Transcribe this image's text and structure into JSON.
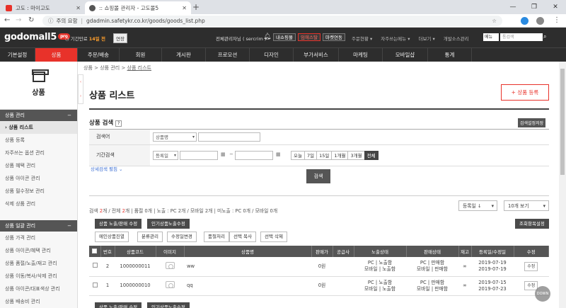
{
  "browser": {
    "tabs": [
      {
        "title": "고도 : 마이고도",
        "favicon_color": "#e8322a"
      },
      {
        "title": ":: 쇼핑몰 관리자 - 고도몰5",
        "favicon_color": "#555555"
      }
    ],
    "url_security": "주의 요함",
    "url": "gdadmin.safetykr.co.kr/goods/goods_list.php",
    "window_controls": [
      "—",
      "❐",
      "✕"
    ]
  },
  "header": {
    "logo_text": "godomall",
    "logo_num": "5",
    "logo_badge": "pro",
    "trial_prefix": "기간만료",
    "trial_days": "14일 전",
    "extend_label": "연장",
    "admin_label": "전체관리자님 ( sercrim )",
    "buttons": [
      "내쇼핑몰",
      "임에스탈",
      "마켓연동"
    ],
    "links": [
      "주문현황 ▾",
      "자주쓰는메뉴 ▾",
      "더보기 ▾",
      "개발소스관리"
    ],
    "menu_select": "메뉴",
    "search_placeholder": "통검색"
  },
  "gnb": [
    "기본설정",
    "상품",
    "주문/배송",
    "회원",
    "게시판",
    "프로모션",
    "디자인",
    "부가서비스",
    "마케팅",
    "모바일샵",
    "통계"
  ],
  "sidebar": {
    "title": "상품",
    "groups": [
      {
        "label": "상품 관리",
        "items": [
          "› 상품 리스트",
          "상품 등록",
          "자주쓰는 옵션 관리",
          "상품 혜택 관리",
          "상품 아이콘 관리",
          "상품 필수정보 관리",
          "삭제 상품 관리"
        ]
      },
      {
        "label": "상품 일괄 관리",
        "items": [
          "상품 가격 관리",
          "상품 아이콘/혜택 관리",
          "상품 품절/노출/재고 관리",
          "상품 이동/복사/삭제 관리",
          "상품 아이콘/대표색상 관리",
          "상품 배송비 관리"
        ]
      }
    ]
  },
  "content": {
    "breadcrumb": [
      "상품",
      "상품 관리",
      "상품 리스트"
    ],
    "title": "상품 리스트",
    "register_button": "+ 상품 등록",
    "search_section_title": "상품 검색",
    "help_icon": "?",
    "save_condition_button": "검색설정저장",
    "search": {
      "keyword_label": "검색어",
      "keyword_select": "상품명",
      "period_label": "기간검색",
      "period_select": "등록일",
      "tilde": "~",
      "period_buttons": [
        "오늘",
        "7일",
        "15일",
        "1개월",
        "3개월",
        "전체"
      ],
      "period_active": "전체",
      "detail_link": "상세검색 펼침 ⌄",
      "search_button": "검색"
    },
    "counts": {
      "prefix": "검색",
      "search_count": "2",
      "mid": "개 / 전체",
      "total_count": "2",
      "suffix": "개 | 품절 0개 | 노출 : PC 2개 / 모바일 2개 | 미노출 : PC 0개 / 모바일 0개"
    },
    "sort_select": "등록일 ↓",
    "page_size_select": "10개 보기",
    "action_buttons_dark": [
      "상품 노출/판매 수정",
      "인기상품노출수정"
    ],
    "action_button_right": "조회항목설정",
    "action_buttons_light": [
      "메인상품진열",
      "분류관리",
      "수정일변경",
      "품절처리",
      "선택 복사",
      "선택 삭제"
    ],
    "table": {
      "headers": [
        "",
        "번호",
        "상품코드",
        "이미지",
        "상품명",
        "판매가",
        "공급사",
        "노출상태",
        "판매상태",
        "재고",
        "등록일/수정일",
        "수정"
      ],
      "rows": [
        {
          "no": "2",
          "code": "1000000011",
          "name": "ww",
          "price": "0원",
          "supplier": "",
          "display": [
            "PC | 노출함",
            "모바일 | 노출함"
          ],
          "sale": [
            "PC | 판매함",
            "모바일 | 판매함"
          ],
          "stock": "∞",
          "dates": [
            "2019-07-19",
            "2019-07-19"
          ],
          "edit": "수정"
        },
        {
          "no": "1",
          "code": "1000000010",
          "name": "qq",
          "price": "0원",
          "supplier": "",
          "display": [
            "PC | 노출함",
            "모바일 | 노출함"
          ],
          "sale": [
            "PC | 판매함",
            "모바일 | 판매함"
          ],
          "stock": "∞",
          "dates": [
            "2019-07-15",
            "2019-07-23"
          ],
          "edit": "수정"
        }
      ]
    },
    "down_badge": "DOWN"
  }
}
